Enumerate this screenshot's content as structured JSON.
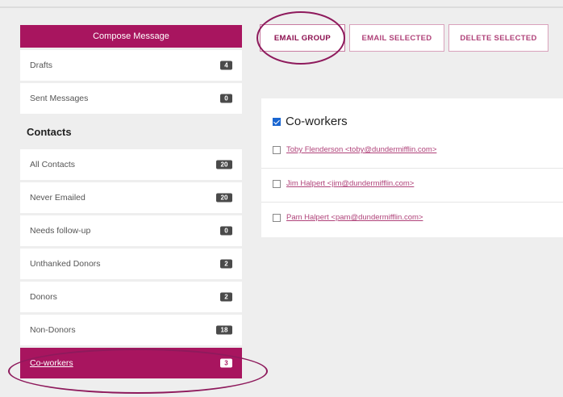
{
  "sidebar": {
    "compose_label": "Compose Message",
    "items": [
      {
        "label": "Drafts",
        "count": "4"
      },
      {
        "label": "Sent Messages",
        "count": "0"
      }
    ],
    "contacts_title": "Contacts",
    "contacts": [
      {
        "label": "All Contacts",
        "count": "20"
      },
      {
        "label": "Never Emailed",
        "count": "20"
      },
      {
        "label": "Needs follow-up",
        "count": "0"
      },
      {
        "label": "Unthanked Donors",
        "count": "2"
      },
      {
        "label": "Donors",
        "count": "2"
      },
      {
        "label": "Non-Donors",
        "count": "18"
      },
      {
        "label": "Co-workers",
        "count": "3"
      }
    ]
  },
  "toolbar": {
    "email_group": "EMAIL GROUP",
    "email_selected": "EMAIL SELECTED",
    "delete_selected": "DELETE SELECTED"
  },
  "group": {
    "name": "Co-workers",
    "checked": true,
    "members": [
      {
        "text": "Toby   Flenderson   <toby@dundermifflin.com>"
      },
      {
        "text": "Jim   Halpert   <jim@dundermifflin.com>"
      },
      {
        "text": "Pam   Halpert   <pam@dundermifflin.com>"
      }
    ]
  },
  "colors": {
    "accent": "#a8155f",
    "link": "#b0437a",
    "badge": "#4a4a4a",
    "annotation": "#8e1a5c"
  }
}
